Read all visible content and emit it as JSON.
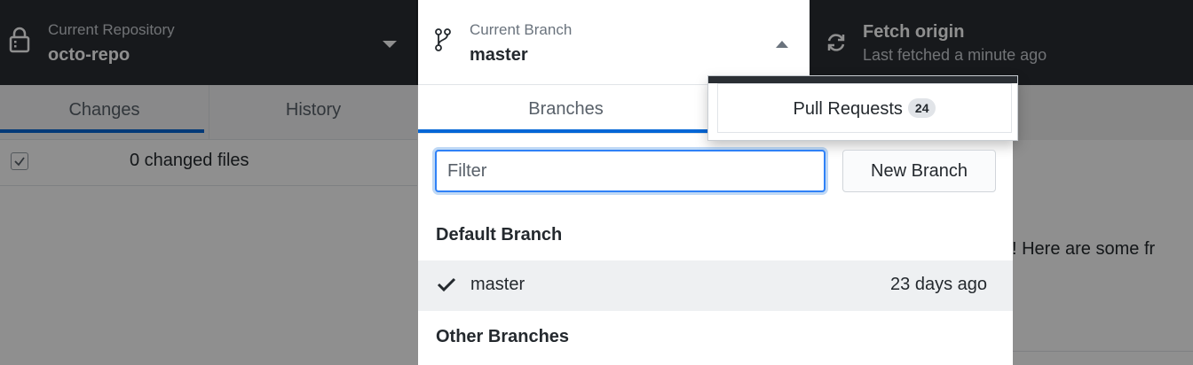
{
  "toolbar": {
    "repository": {
      "title": "Current Repository",
      "name": "octo-repo",
      "icon": "lock-icon"
    },
    "branch": {
      "title": "Current Branch",
      "name": "master",
      "icon": "git-branch-icon"
    },
    "fetch": {
      "title": "Fetch origin",
      "subtitle": "Last fetched a minute ago",
      "icon": "sync-icon"
    }
  },
  "left_tabs": {
    "changes": "Changes",
    "history": "History"
  },
  "changes": {
    "summary": "0 changed files"
  },
  "right_text": "y! Here are some fr",
  "branch_dropdown": {
    "tabs": {
      "branches": "Branches",
      "pull_requests": "Pull Requests",
      "pull_requests_count": "24"
    },
    "filter": {
      "placeholder": "Filter",
      "value": ""
    },
    "new_branch_label": "New Branch",
    "default_group": "Default Branch",
    "other_group": "Other Branches",
    "branches": [
      {
        "name": "master",
        "age": "23 days ago",
        "checked": true
      }
    ]
  },
  "colors": {
    "accent": "#0366d6",
    "toolbar_bg": "#2a2e33"
  }
}
